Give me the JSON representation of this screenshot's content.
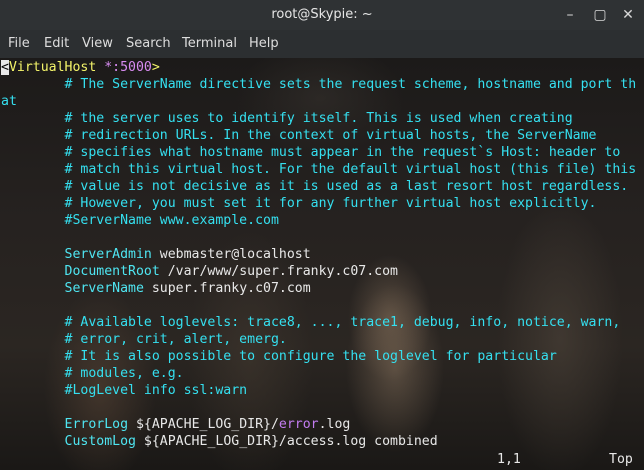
{
  "window": {
    "title": "root@Skypie: ~",
    "controls": [
      "–",
      "▢",
      "✕"
    ]
  },
  "menu": [
    "File",
    "Edit",
    "View",
    "Search",
    "Terminal",
    "Help"
  ],
  "editor": {
    "vh_open": "<",
    "vh_tag": "VirtualHost",
    "vh_port": " *:5000",
    "vh_close": ">",
    "comment_lines": [
      "        # The ServerName directive sets the request scheme, hostname and port th",
      "at",
      "        # the server uses to identify itself. This is used when creating",
      "        # redirection URLs. In the context of virtual hosts, the ServerName",
      "        # specifies what hostname must appear in the request`s Host: header to",
      "        # match this virtual host. For the default virtual host (this file) this",
      "        # value is not decisive as it is used as a last resort host regardless.",
      "        # However, you must set it for any further virtual host explicitly.",
      "        #ServerName www.example.com"
    ],
    "directives": [
      {
        "key": "        ServerAdmin",
        "value": " webmaster@localhost"
      },
      {
        "key": "        DocumentRoot",
        "value": " /var/www/super.franky.c07.com"
      },
      {
        "key": "        ServerName",
        "value": " super.franky.c07.com"
      }
    ],
    "loglevel_comments": [
      "        # Available loglevels: trace8, ..., trace1, debug, info, notice, warn,",
      "        # error, crit, alert, emerg.",
      "        # It is also possible to configure the loglevel for particular",
      "        # modules, e.g.",
      "        #LogLevel info ssl:warn"
    ],
    "errorlog": {
      "key": "        ErrorLog",
      "pre": " ${APACHE_LOG_DIR}/",
      "err": "error",
      "post": ".log"
    },
    "customlog": {
      "key": "        CustomLog",
      "value": " ${APACHE_LOG_DIR}/access.log combined"
    }
  },
  "status": {
    "position": "1,1",
    "scroll": "Top"
  },
  "colors": {
    "comment": "#35e0f0",
    "tag": "#f4f46a",
    "port": "#d88cf2",
    "titlebar": "#2f3234",
    "menubar": "#2c2f31"
  }
}
